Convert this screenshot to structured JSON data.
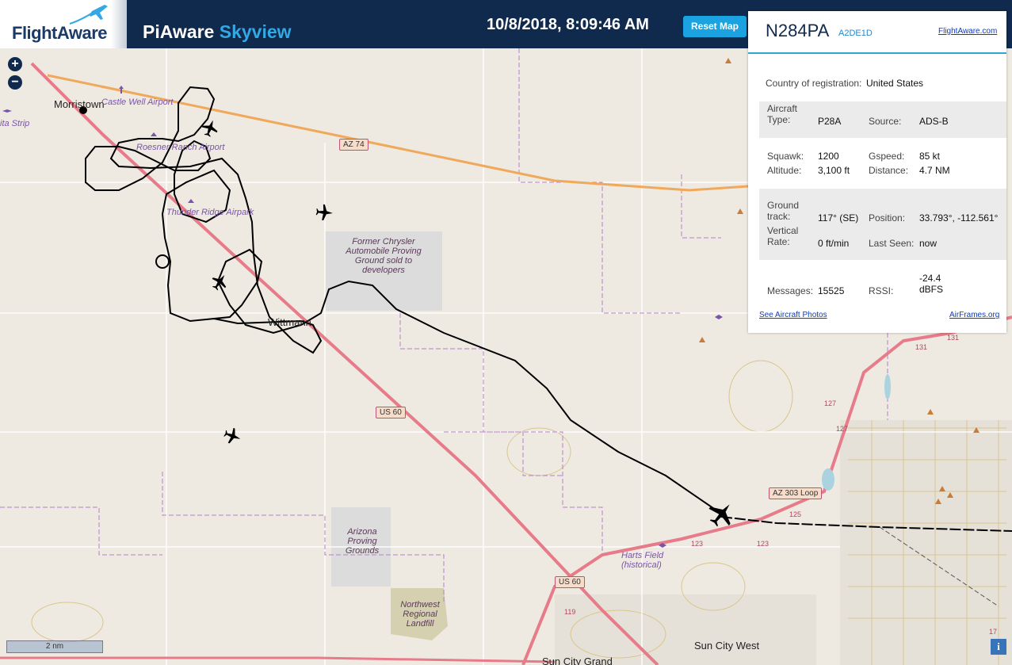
{
  "header": {
    "logo_text": "FlightAware",
    "app_title": "PiAware",
    "app_title_accent": "Skyview",
    "clock": "10/8/2018, 8:09:46 AM",
    "reset_button": "Reset Map"
  },
  "map": {
    "zoom_in": "+",
    "zoom_out": "−",
    "scale_label": "2 nm",
    "info_button": "i",
    "places": {
      "morristown": "Morristown",
      "castle_well": "Castle Well Airport",
      "ita_strip": "ita Strip",
      "roesner": "Roesner Ranch Airport",
      "thunder": "Thunder Ridge Airpark",
      "wittmann": "Wittmann",
      "chrysler": "Former Chrysler Automobile Proving Ground sold to developers",
      "arizona_pg": "Arizona Proving Grounds",
      "landfill": "Northwest Regional Landfill",
      "harts_field": "Harts Field (historical)",
      "sun_city_west": "Sun City West",
      "sun_city_grand": "Sun City Grand"
    },
    "roads": {
      "az74": "AZ 74",
      "us60_a": "US 60",
      "us60_b": "US 60",
      "az303": "AZ 303 Loop"
    },
    "exits": [
      "131",
      "131",
      "127",
      "127",
      "125",
      "123",
      "123",
      "119",
      "17"
    ]
  },
  "panel": {
    "tail_number": "N284PA",
    "hex": "A2DE1D",
    "fa_link": "FlightAware.com",
    "country_label": "Country of registration:",
    "country_value": "United States",
    "aircraft_type_label": "Aircraft Type:",
    "aircraft_type_value": "P28A",
    "source_label": "Source:",
    "source_value": "ADS-B",
    "squawk_label": "Squawk:",
    "squawk_value": "1200",
    "gspeed_label": "Gspeed:",
    "gspeed_value": "85 kt",
    "altitude_label": "Altitude:",
    "altitude_value": "3,100 ft",
    "distance_label": "Distance:",
    "distance_value": "4.7 NM",
    "track_label": "Ground track:",
    "track_value": "117° (SE)",
    "position_label": "Position:",
    "position_value": "33.793°, -112.561°",
    "vrate_label": "Vertical Rate:",
    "vrate_value": "0 ft/min",
    "lastseen_label": "Last Seen:",
    "lastseen_value": "now",
    "messages_label": "Messages:",
    "messages_value": "15525",
    "rssi_label": "RSSI:",
    "rssi_value": "-24.4 dBFS",
    "photos_link": "See Aircraft Photos",
    "airframes_link": "AirFrames.org"
  },
  "colors": {
    "header_bg": "#0f2a4d",
    "accent": "#1ba2e0",
    "panel_rule": "#2fa7d1"
  }
}
